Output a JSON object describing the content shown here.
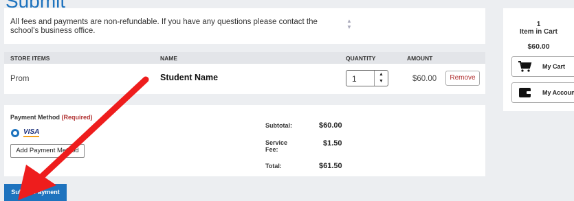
{
  "page": {
    "title": "Submit"
  },
  "notice": {
    "text": "All fees and payments are non-refundable. If you have any questions please contact the school's business office."
  },
  "table": {
    "headers": {
      "store_items": "STORE ITEMS",
      "name": "NAME",
      "quantity": "QUANTITY",
      "amount": "AMOUNT"
    },
    "rows": [
      {
        "store_item": "Prom",
        "name": "Student Name",
        "quantity": "1",
        "amount": "$60.00",
        "remove_label": "Remove"
      }
    ]
  },
  "payment": {
    "label": "Payment Method",
    "required": "(Required)",
    "card_brand": "VISA",
    "add_button": "Add Payment Method"
  },
  "totals": {
    "subtotal_label": "Subtotal:",
    "subtotal_value": "$60.00",
    "service_fee_label": "Service Fee:",
    "service_fee_value": "$1.50",
    "total_label": "Total:",
    "total_value": "$61.50"
  },
  "submit": {
    "label": "Submit Payment"
  },
  "cart": {
    "count": "1",
    "count_label": "Item in Cart",
    "total": "$60.00",
    "my_cart_label": "My Cart",
    "my_account_label": "My Account"
  },
  "colors": {
    "accent": "#1e73be",
    "danger": "#b03030",
    "annotation_arrow": "#ee1d1d"
  },
  "icons": [
    "cart-icon",
    "wallet-icon",
    "sort-icon",
    "radio-icon"
  ]
}
